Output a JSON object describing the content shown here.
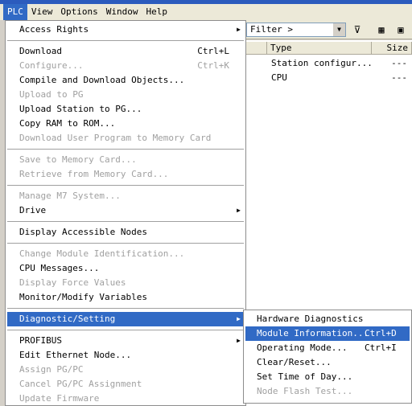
{
  "menubar": [
    "PLC",
    "View",
    "Options",
    "Window",
    "Help"
  ],
  "toolbar": {
    "filter": "Filter >",
    "dropdown_icon": "chevron-down-icon",
    "icons": [
      "filter-edit-icon",
      "network-icon",
      "module-icon"
    ]
  },
  "list": {
    "columns": [
      "Type",
      "Size"
    ],
    "rows": [
      {
        "type": "Station configur...",
        "size": "---"
      },
      {
        "type": "CPU",
        "size": "---"
      }
    ]
  },
  "plc_menu": [
    {
      "label": "Access Rights",
      "submenu": true
    },
    {
      "sep": true
    },
    {
      "label": "Download",
      "shortcut": "Ctrl+L"
    },
    {
      "label": "Configure...",
      "shortcut": "Ctrl+K",
      "disabled": true
    },
    {
      "label": "Compile and Download Objects..."
    },
    {
      "label": "Upload to PG",
      "disabled": true
    },
    {
      "label": "Upload Station to PG..."
    },
    {
      "label": "Copy RAM to ROM..."
    },
    {
      "label": "Download User Program to Memory Card",
      "disabled": true
    },
    {
      "sep": true
    },
    {
      "label": "Save to Memory Card...",
      "disabled": true
    },
    {
      "label": "Retrieve from Memory Card...",
      "disabled": true
    },
    {
      "sep": true
    },
    {
      "label": "Manage M7 System...",
      "disabled": true
    },
    {
      "label": "Drive",
      "submenu": true
    },
    {
      "sep": true
    },
    {
      "label": "Display Accessible Nodes"
    },
    {
      "sep": true
    },
    {
      "label": "Change Module Identification...",
      "disabled": true
    },
    {
      "label": "CPU Messages..."
    },
    {
      "label": "Display Force Values",
      "disabled": true
    },
    {
      "label": "Monitor/Modify Variables"
    },
    {
      "sep": true
    },
    {
      "label": "Diagnostic/Setting",
      "submenu": true,
      "highlighted": true
    },
    {
      "sep": true
    },
    {
      "label": "PROFIBUS",
      "submenu": true
    },
    {
      "label": "Edit Ethernet Node..."
    },
    {
      "label": "Assign PG/PC",
      "disabled": true
    },
    {
      "label": "Cancel PG/PC Assignment",
      "disabled": true
    },
    {
      "label": "Update Firmware",
      "disabled": true
    }
  ],
  "diag_submenu": [
    {
      "label": "Hardware Diagnostics"
    },
    {
      "label": "Module Information...",
      "shortcut": "Ctrl+D",
      "highlighted": true
    },
    {
      "label": "Operating Mode...",
      "shortcut": "Ctrl+I"
    },
    {
      "label": "Clear/Reset..."
    },
    {
      "label": "Set Time of Day..."
    },
    {
      "label": "Node Flash Test...",
      "disabled": true
    }
  ],
  "colors": {
    "highlight": "#316ac5",
    "disabled": "#a0a0a0"
  }
}
